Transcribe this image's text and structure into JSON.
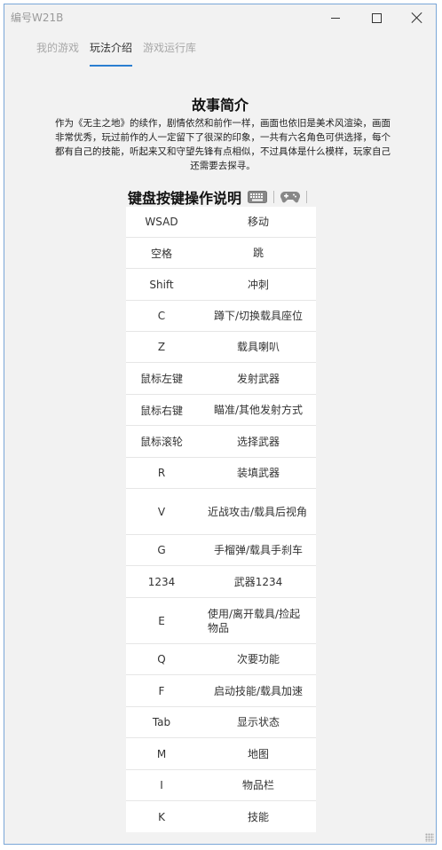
{
  "window": {
    "title": "编号W21B"
  },
  "tabs": [
    {
      "label": "我的游戏",
      "active": false
    },
    {
      "label": "玩法介绍",
      "active": true
    },
    {
      "label": "游戏运行库",
      "active": false
    }
  ],
  "story": {
    "title": "故事简介",
    "text": "作为《无主之地》的续作，剧情依然和前作一样，画面也依旧是美术风渲染，画面非常优秀，玩过前作的人一定留下了很深的印象，一共有六名角色可供选择，每个都有自己的技能，听起来又和守望先锋有点相似，不过具体是什么模样，玩家自己还需要去探寻。"
  },
  "keyboard": {
    "title": "键盘按键操作说明",
    "icons": [
      "keyboard-icon",
      "gamepad-icon"
    ],
    "rows": [
      {
        "key": "WSAD",
        "action": "移动"
      },
      {
        "key": "空格",
        "action": "跳"
      },
      {
        "key": "Shift",
        "action": "冲刺"
      },
      {
        "key": "C",
        "action": "蹲下/切换载具座位"
      },
      {
        "key": "Z",
        "action": "载具喇叭"
      },
      {
        "key": "鼠标左键",
        "action": "发射武器"
      },
      {
        "key": "鼠标右键",
        "action": "瞄准/其他发射方式"
      },
      {
        "key": "鼠标滚轮",
        "action": "选择武器"
      },
      {
        "key": "R",
        "action": "装填武器"
      },
      {
        "key": "V",
        "action": "近战攻击/载具后视角"
      },
      {
        "key": "G",
        "action": "手榴弹/载具手刹车"
      },
      {
        "key": "1234",
        "action": "武器1234"
      },
      {
        "key": "E",
        "action": "使用/离开载具/捡起物品"
      },
      {
        "key": "Q",
        "action": "次要功能"
      },
      {
        "key": "F",
        "action": "启动技能/载具加速"
      },
      {
        "key": "Tab",
        "action": "显示状态"
      },
      {
        "key": "M",
        "action": "地图"
      },
      {
        "key": "I",
        "action": "物品栏"
      },
      {
        "key": "K",
        "action": "技能"
      }
    ]
  },
  "colors": {
    "accent": "#2b7fd1",
    "window_border": "#7aa7d8",
    "background": "#f2f2f2"
  }
}
